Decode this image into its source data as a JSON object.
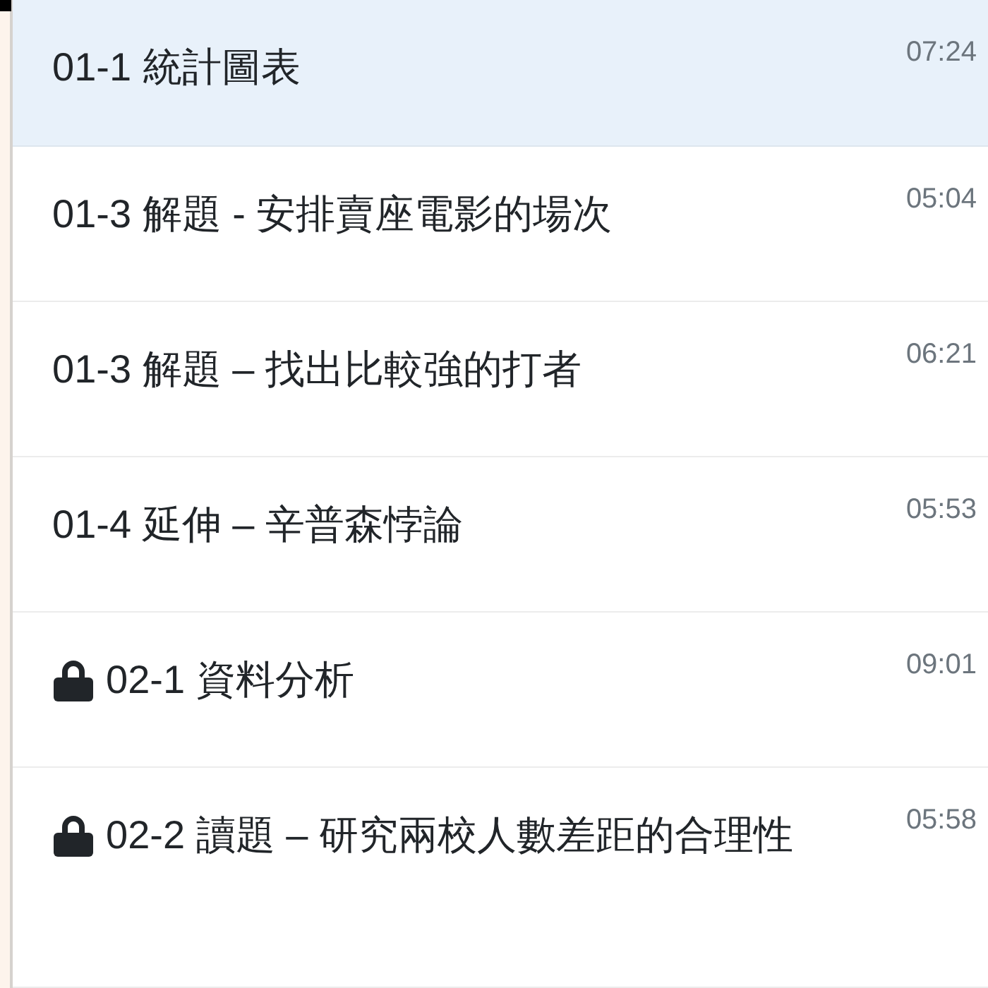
{
  "lessons": [
    {
      "title": "01-1 統計圖表",
      "duration": "07:24",
      "locked": false,
      "selected": true
    },
    {
      "title": "01-3 解題 - 安排賣座電影的場次",
      "duration": "05:04",
      "locked": false,
      "selected": false
    },
    {
      "title": "01-3 解題 – 找出比較強的打者",
      "duration": "06:21",
      "locked": false,
      "selected": false
    },
    {
      "title": "01-4 延伸 – 辛普森悖論",
      "duration": "05:53",
      "locked": false,
      "selected": false
    },
    {
      "title": "02-1 資料分析",
      "duration": "09:01",
      "locked": true,
      "selected": false
    },
    {
      "title": "02-2 讀題 – 研究兩校人數差距的合理性",
      "duration": "05:58",
      "locked": true,
      "selected": false
    }
  ]
}
